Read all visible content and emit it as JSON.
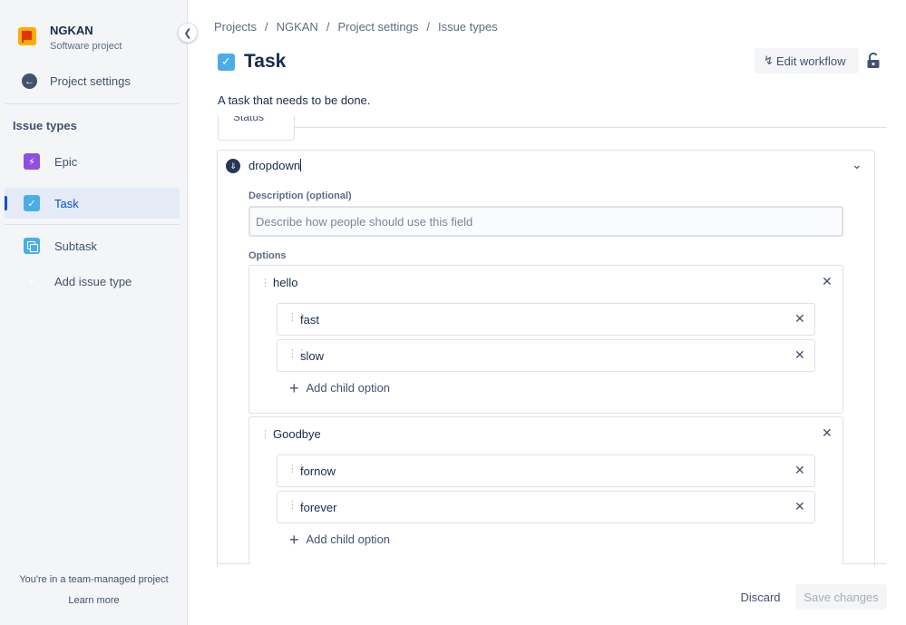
{
  "project": {
    "name": "NGKAN",
    "type": "Software project"
  },
  "sidebar": {
    "back_label": "Project settings",
    "heading": "Issue types",
    "items": [
      {
        "label": "Epic",
        "icon": "epic-icon"
      },
      {
        "label": "Task",
        "icon": "task-icon",
        "selected": true
      },
      {
        "label": "Subtask",
        "icon": "subtask-icon"
      },
      {
        "label": "Add issue type",
        "icon": "plus-icon"
      }
    ],
    "footer_text": "You're in a team-managed project",
    "footer_link": "Learn more"
  },
  "breadcrumb": [
    "Projects",
    "NGKAN",
    "Project settings",
    "Issue types"
  ],
  "header": {
    "title": "Task",
    "edit_workflow_label": "Edit workflow",
    "description": "A task that needs to be done."
  },
  "tab_status_label": "Status",
  "field": {
    "name": "dropdown",
    "description_label": "Description (optional)",
    "description_placeholder": "Describe how people should use this field",
    "description_value": "",
    "options_label": "Options",
    "options": [
      {
        "label": "hello",
        "children": [
          "fast",
          "slow"
        ],
        "add_child_label": "Add child option"
      },
      {
        "label": "Goodbye",
        "children": [
          "fornow",
          "forever"
        ],
        "add_child_label": "Add child option"
      }
    ]
  },
  "footer_actions": {
    "discard_label": "Discard",
    "save_label": "Save changes"
  },
  "colors": {
    "accent": "#0052cc",
    "task": "#4bade8",
    "epic": "#904ee2",
    "project_logo": "#ffab00"
  }
}
